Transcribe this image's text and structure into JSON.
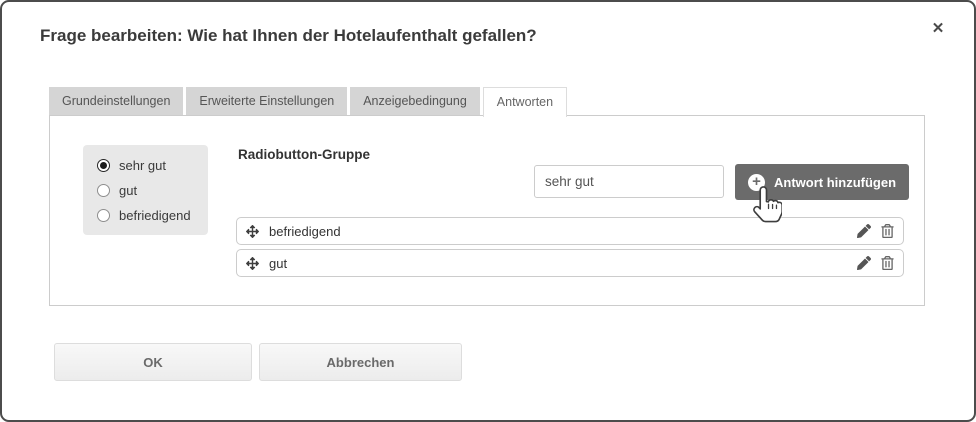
{
  "dialog": {
    "title": "Frage bearbeiten: Wie hat Ihnen der Hotelaufenthalt gefallen?",
    "close_glyph": "✕"
  },
  "tabs": [
    {
      "label": "Grundeinstellungen",
      "active": false
    },
    {
      "label": "Erweiterte Einstellungen",
      "active": false
    },
    {
      "label": "Anzeigebedingung",
      "active": false
    },
    {
      "label": "Antworten",
      "active": true
    }
  ],
  "preview": {
    "options": [
      {
        "label": "sehr gut",
        "selected": true
      },
      {
        "label": "gut",
        "selected": false
      },
      {
        "label": "befriedigend",
        "selected": false
      }
    ]
  },
  "answers_panel": {
    "heading": "Radiobutton-Gruppe",
    "input_value": "sehr gut",
    "add_button_label": "Antwort hinzufügen",
    "plus_glyph": "+",
    "answers": [
      "befriedigend",
      "gut"
    ]
  },
  "footer": {
    "ok_label": "OK",
    "cancel_label": "Abbrechen"
  },
  "icons": [
    "close-icon",
    "plus-icon",
    "move-icon",
    "pencil-icon",
    "trash-icon",
    "hand-pointer-cursor"
  ],
  "colors": {
    "modal_border": "#4c4c4c",
    "tab_inactive_bg": "#d5d5d5",
    "panel_border": "#cccccc",
    "preview_bg": "#e8e8e8",
    "add_button_bg": "#6b6b6b",
    "footer_button_bg": "#f3f3f3",
    "text_primary": "#3b3b3b",
    "text_secondary": "#555555"
  }
}
